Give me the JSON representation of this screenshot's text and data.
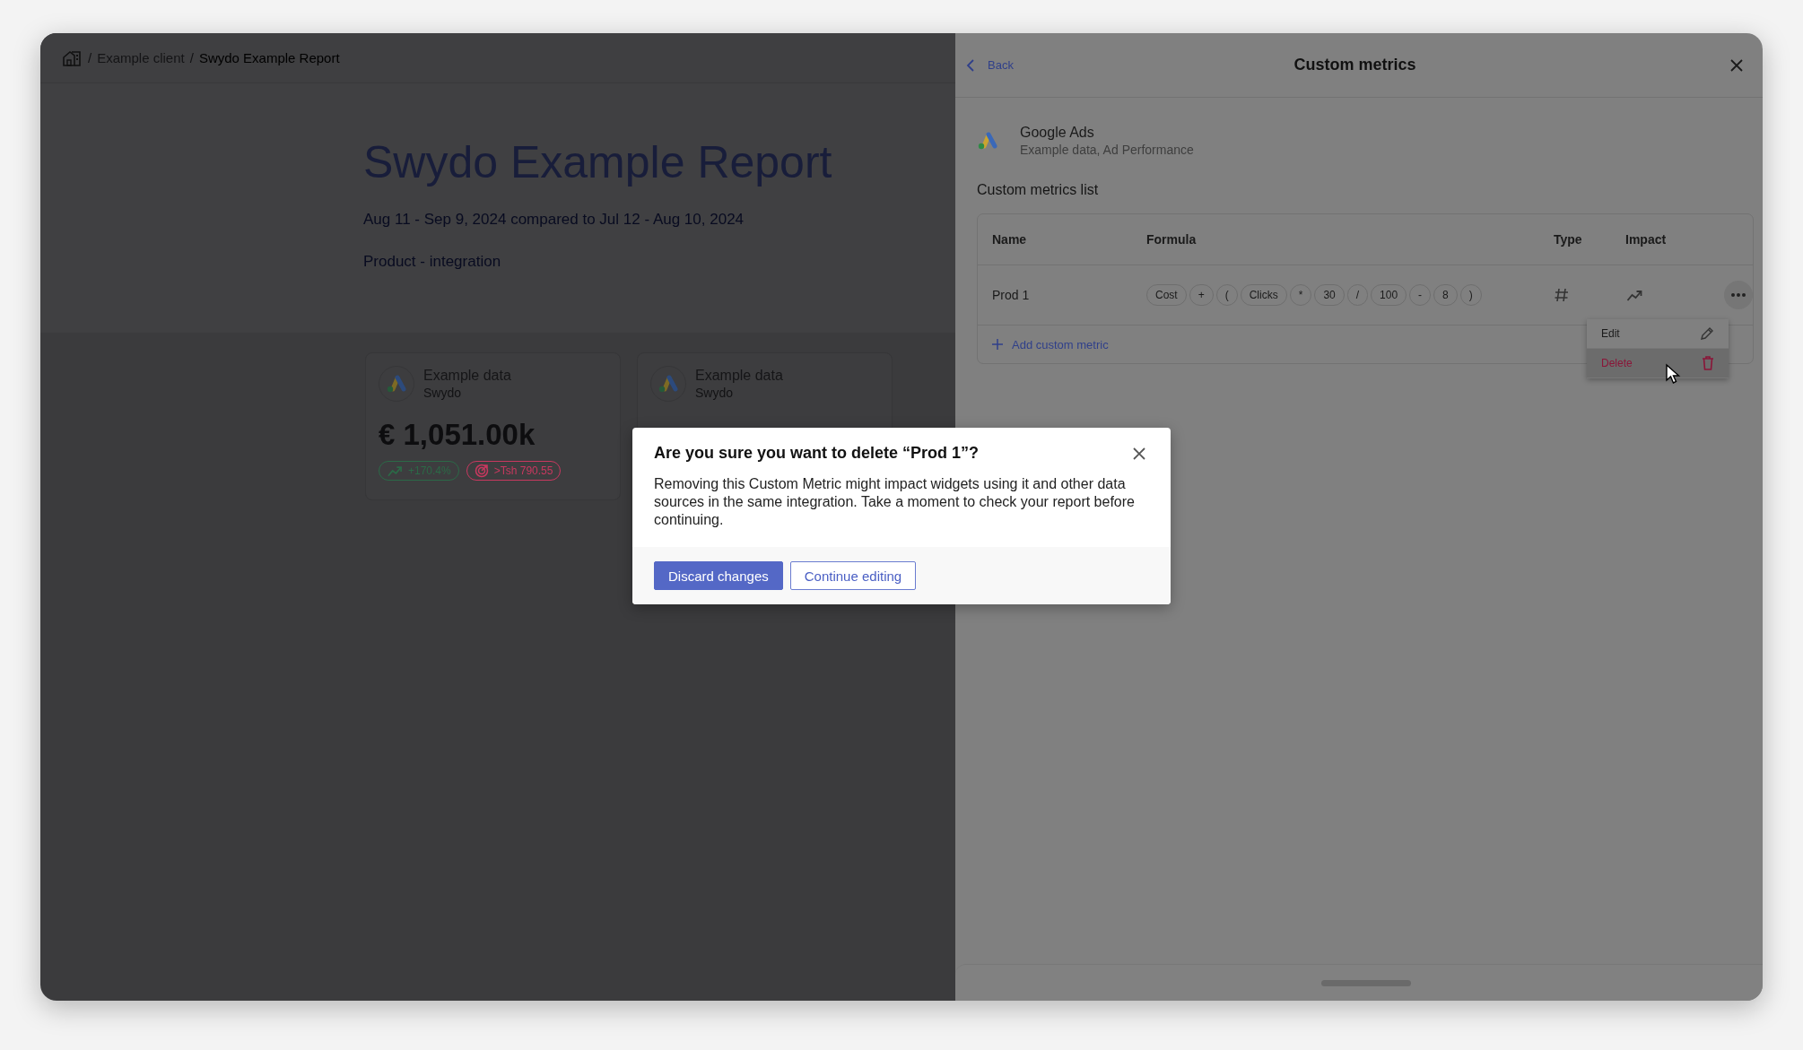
{
  "breadcrumb": {
    "separator": "/",
    "items": [
      {
        "label": "Example client",
        "current": false
      },
      {
        "label": "Swydo Example Report",
        "current": true
      }
    ]
  },
  "report": {
    "title": "Swydo Example Report",
    "date_range": "Aug 11 - Sep 9, 2024 compared to Jul 12 - Aug 10, 2024",
    "subtitle": "Product - integration"
  },
  "cards": [
    {
      "title": "Example data",
      "source": "Swydo",
      "value": "€ 1,051.00k",
      "badges": [
        {
          "kind": "trend",
          "text": "+170.4%",
          "color": "#2b6a47"
        },
        {
          "kind": "target",
          "text": ">Tsh 790.55",
          "color": "#c8385f"
        }
      ]
    },
    {
      "title": "Example data",
      "source": "Swydo"
    }
  ],
  "panel": {
    "back": "Back",
    "title": "Custom metrics",
    "source": {
      "name": "Google Ads",
      "detail": "Example data, Ad Performance"
    },
    "list_title": "Custom metrics list",
    "table": {
      "columns": [
        "Name",
        "Formula",
        "Type",
        "Impact"
      ],
      "rows": [
        {
          "name": "Prod 1",
          "formula": [
            "Cost",
            "+",
            "(",
            "Clicks",
            "*",
            "30",
            "/",
            "100",
            "-",
            "8",
            ")"
          ],
          "type": {
            "kind": "number"
          },
          "impact": {
            "kind": "trend"
          }
        }
      ]
    },
    "add_button": "Add custom metric",
    "menu": [
      {
        "kind": "edit",
        "label": "Edit",
        "highlighted": false
      },
      {
        "kind": "delete",
        "label": "Delete",
        "highlighted": true
      }
    ]
  },
  "dialog": {
    "title": "Are you sure you want to delete “Prod 1”?",
    "body": "Removing this Custom Metric might impact widgets using it and other data sources in the same integration. Take a moment to check your report before continuing.",
    "buttons": [
      {
        "label": "Discard changes",
        "kind": "primary"
      },
      {
        "label": "Continue editing",
        "kind": "secondary"
      }
    ]
  }
}
